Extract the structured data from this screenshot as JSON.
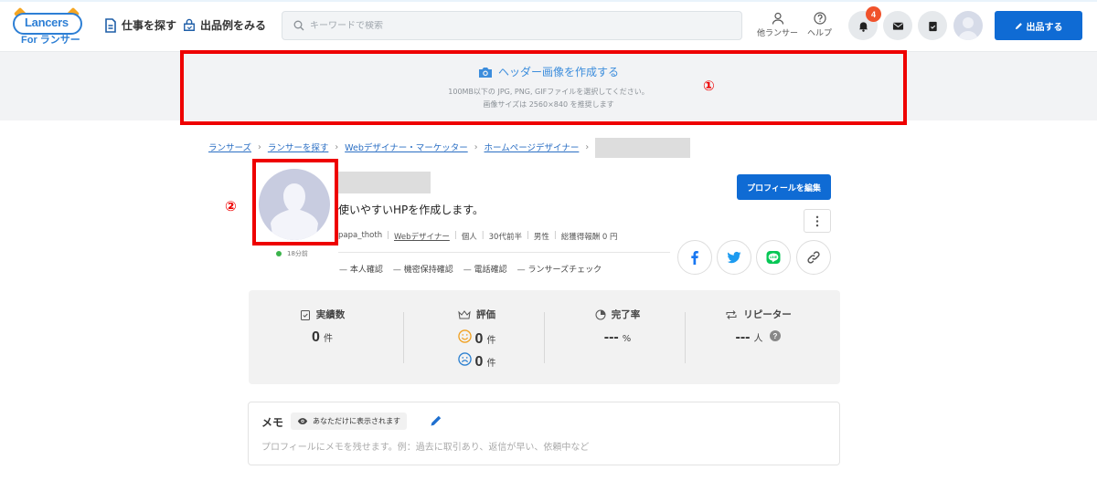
{
  "nav": {
    "logo_line1": "Lancers",
    "logo_line2": "For ランサー",
    "find_work": "仕事を探す",
    "see_listings": "出品例をみる",
    "search_placeholder": "キーワードで検索",
    "other_lancers": "他ランサー",
    "help": "ヘルプ",
    "notification_count": "4",
    "post_button": "出品する",
    "colors": {
      "primary": "#0f6bd4",
      "badge": "#f0522b"
    }
  },
  "header_image": {
    "title": "ヘッダー画像を作成する",
    "line1": "100MB以下の JPG, PNG, GIFファイルを選択してください。",
    "line2": "画像サイズは 2560×840 を推奨します",
    "annotation_number": "①"
  },
  "breadcrumb": [
    "ランサーズ",
    "ランサーを探す",
    "Webデザイナー・マーケッター",
    "ホームページデザイナー"
  ],
  "profile": {
    "annotation_number": "②",
    "last_active": "18分前",
    "catchphrase": "使いやすいHPを作成します。",
    "username": "papa_thoth",
    "occupation": "Webデザイナー",
    "type": "個人",
    "age": "30代前半",
    "gender": "男性",
    "total_earnings": "総獲得報酬 0 円",
    "verifications": [
      "本人確認",
      "機密保持確認",
      "電話確認",
      "ランサーズチェック"
    ],
    "edit_button": "プロフィールを編集"
  },
  "stats": {
    "achievements_label": "実績数",
    "achievements_value": "0",
    "achievements_unit": "件",
    "rating_label": "評価",
    "rating_good": "0",
    "rating_bad": "0",
    "rating_unit": "件",
    "completion_label": "完了率",
    "completion_value": "---",
    "completion_unit": "%",
    "repeater_label": "リピーター",
    "repeater_value": "---",
    "repeater_unit": "人"
  },
  "memo": {
    "title": "メモ",
    "visibility": "あなただけに表示されます",
    "placeholder": "プロフィールにメモを残せます。例：過去に取引あり、返信が早い、依頼中など"
  }
}
